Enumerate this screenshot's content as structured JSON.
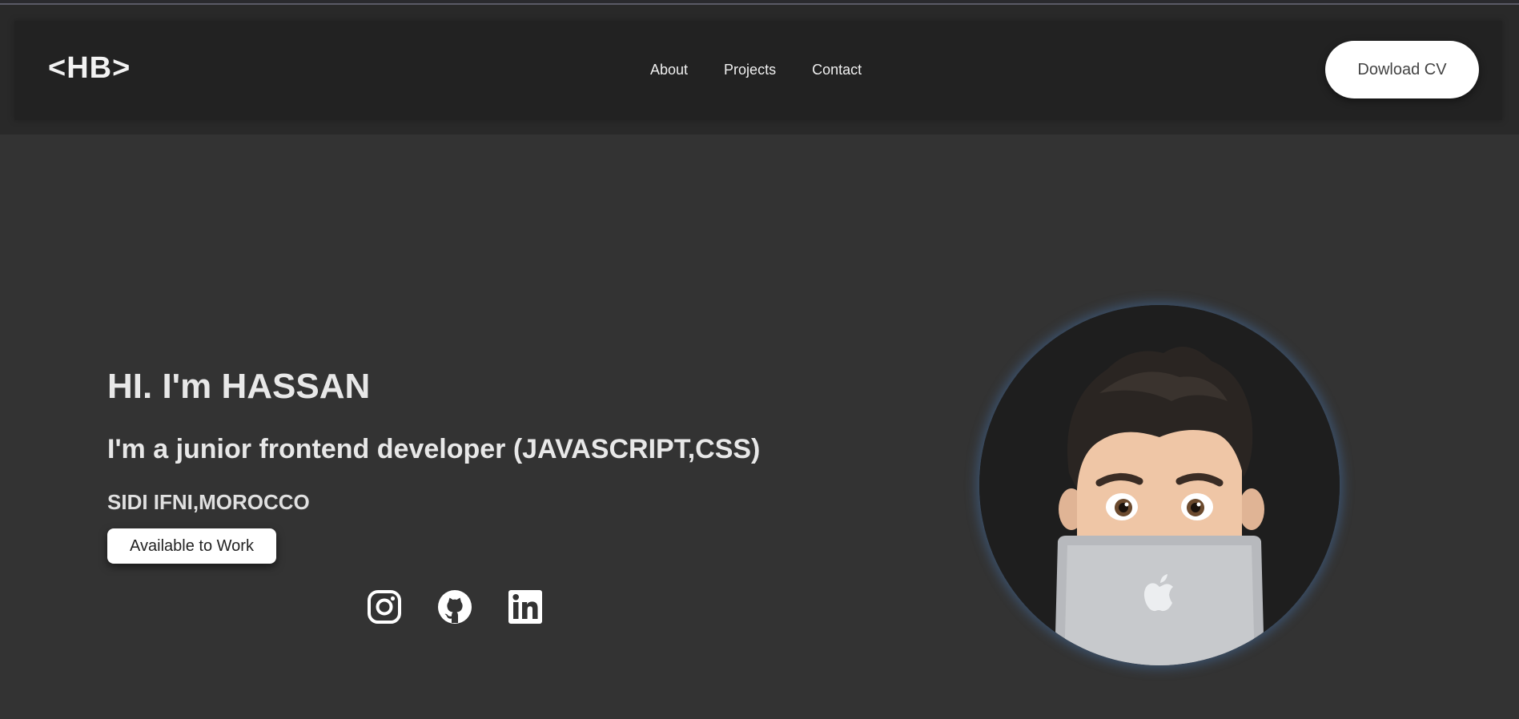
{
  "header": {
    "logo": "<HB>",
    "nav": [
      {
        "label": "About"
      },
      {
        "label": "Projects"
      },
      {
        "label": "Contact"
      }
    ],
    "cv_button": "Dowload CV"
  },
  "hero": {
    "title": "HI. I'm HASSAN",
    "subtitle": "I'm a junior frontend developer (JAVASCRIPT,CSS)",
    "location": "SIDI IFNI,MOROCCO",
    "available_button": "Available to Work",
    "socials": [
      {
        "icon": "instagram-icon"
      },
      {
        "icon": "github-icon"
      },
      {
        "icon": "linkedin-icon"
      }
    ],
    "avatar": {
      "icon": "memoji-avatar-with-laptop"
    }
  },
  "colors": {
    "page_bg": "#333333",
    "navbar_bg": "#222222",
    "text": "#e8e8e8",
    "button_bg": "#ffffff",
    "avatar_glow": "#4678b4"
  }
}
